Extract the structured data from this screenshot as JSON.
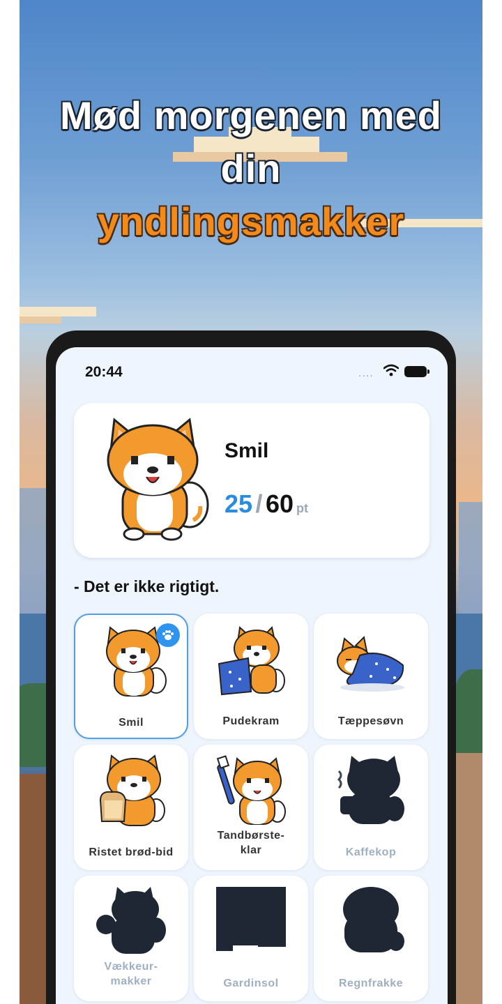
{
  "promo": {
    "headline_line1": "Mød morgenen med",
    "headline_line2": "din",
    "headline_highlight": "yndlingsmakker",
    "highlight_color": "#f28a1c"
  },
  "status_bar": {
    "time": "20:44",
    "signal_icon": "signal-dots-icon",
    "wifi_icon": "wifi-icon",
    "battery_icon": "battery-icon"
  },
  "current_pet": {
    "name": "Smil",
    "score_current": "25",
    "score_separator": "/",
    "score_max": "60",
    "score_unit": "pt",
    "accent_color": "#2a8be0"
  },
  "quote": "- Det er ikke rigtigt.",
  "collection": [
    {
      "label": "Smil",
      "state": "selected",
      "icon": "shiba-sitting-icon",
      "badge_icon": "paw-icon"
    },
    {
      "label": "Pudekram",
      "state": "unlocked",
      "icon": "shiba-pillow-icon"
    },
    {
      "label": "Tæppesøvn",
      "state": "unlocked",
      "icon": "shiba-blanket-icon"
    },
    {
      "label": "Ristet brød-bid",
      "state": "unlocked",
      "icon": "shiba-toast-icon"
    },
    {
      "label": "Tandbørste-",
      "label2": "klar",
      "state": "unlocked",
      "icon": "shiba-toothbrush-icon"
    },
    {
      "label": "Kaffekop",
      "state": "locked",
      "icon": "silhouette-coffee-icon"
    },
    {
      "label": "Vækkeur-",
      "label2": "makker",
      "state": "locked",
      "icon": "silhouette-alarm-icon"
    },
    {
      "label": "Gardinsol",
      "state": "locked",
      "icon": "silhouette-curtain-icon"
    },
    {
      "label": "Regnfrakke",
      "state": "locked",
      "icon": "silhouette-raincoat-icon"
    }
  ]
}
